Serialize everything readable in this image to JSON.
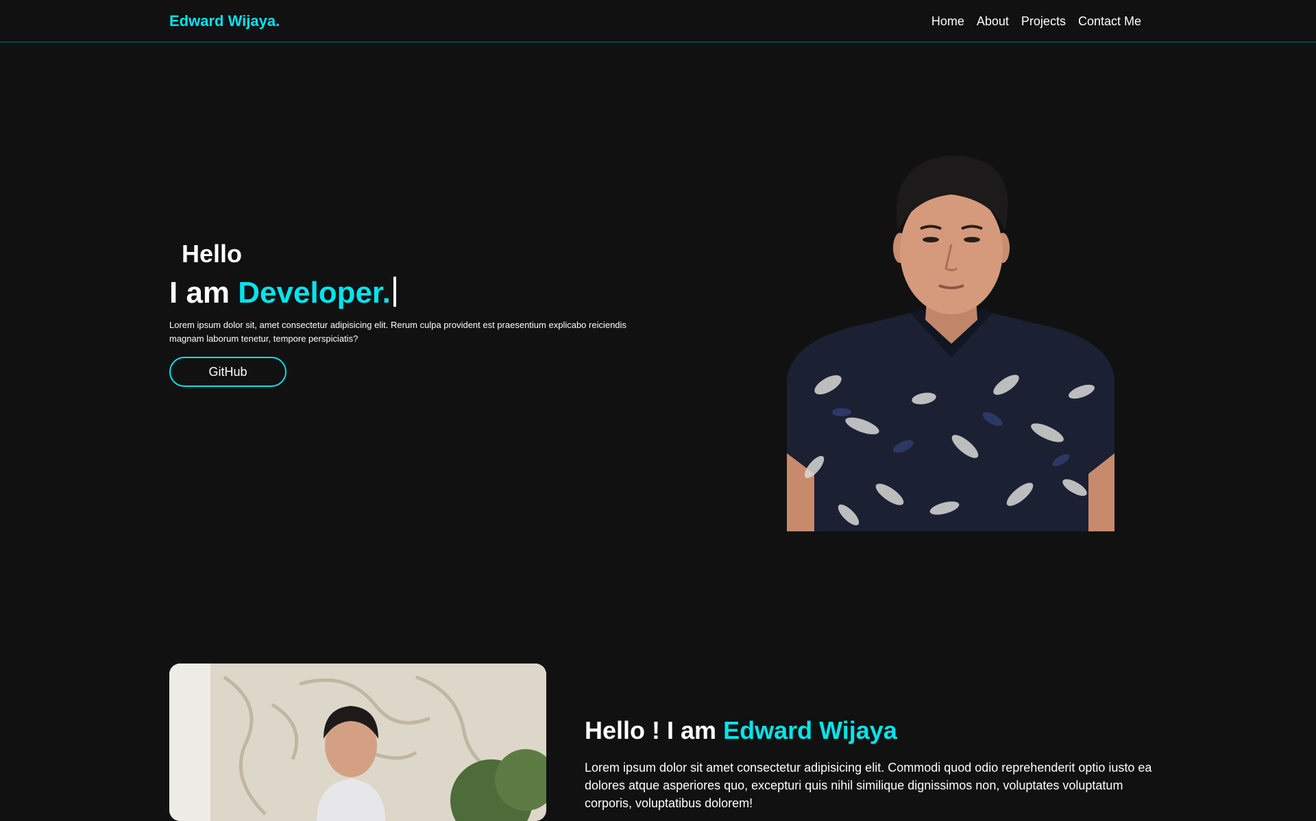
{
  "nav": {
    "brand": "Edward Wijaya.",
    "links": [
      "Home",
      "About",
      "Projects",
      "Contact Me"
    ]
  },
  "hero": {
    "greeting": "Hello",
    "title_prefix": "I am",
    "title_accent": "Developer.",
    "description": "Lorem ipsum dolor sit, amet consectetur adipisicing elit. Rerum culpa provident est praesentium explicabo reiciendis magnam laborum tenetur, tempore perspiciatis?",
    "button_label": "GitHub"
  },
  "about": {
    "heading_prefix": "Hello ! I am",
    "heading_accent": "Edward Wijaya",
    "text": "Lorem ipsum dolor sit amet consectetur adipisicing elit. Commodi quod odio reprehenderit optio iusto ea dolores atque asperiores quo, excepturi quis nihil similique dignissimos non, voluptates voluptatum corporis, voluptatibus dolorem!"
  },
  "colors": {
    "background": "#111112",
    "accent": "#00e5ec",
    "text": "#ffffff"
  }
}
